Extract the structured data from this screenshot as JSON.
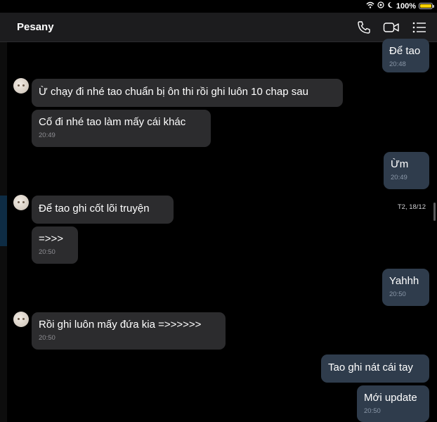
{
  "status": {
    "battery": "100%"
  },
  "header": {
    "title": "Pesany"
  },
  "date_separator": "T2, 18/12",
  "messages": [
    {
      "text": "Để tao",
      "time": "20:48",
      "dir": "out"
    },
    {
      "text": "Ừ chạy đi nhé tao chuẩn bị ôn thi rồi ghi luôn 10 chap sau",
      "dir": "in"
    },
    {
      "text": "Cố đi nhé tao làm mấy cái khác",
      "time": "20:49",
      "dir": "in"
    },
    {
      "text": "Ừm",
      "time": "20:49",
      "dir": "out"
    },
    {
      "text": "Để tao ghi cốt lõi truyện",
      "dir": "in"
    },
    {
      "text": "=>>>",
      "time": "20:50",
      "dir": "in"
    },
    {
      "text": "Yahhh",
      "time": "20:50",
      "dir": "out"
    },
    {
      "text": "Rồi ghi luôn mấy đứa kia =>>>>>>",
      "time": "20:50",
      "dir": "in"
    },
    {
      "text": "Tao ghi nát cái tay",
      "dir": "out"
    },
    {
      "text": "Mới update",
      "time": "20:50",
      "dir": "out"
    }
  ]
}
